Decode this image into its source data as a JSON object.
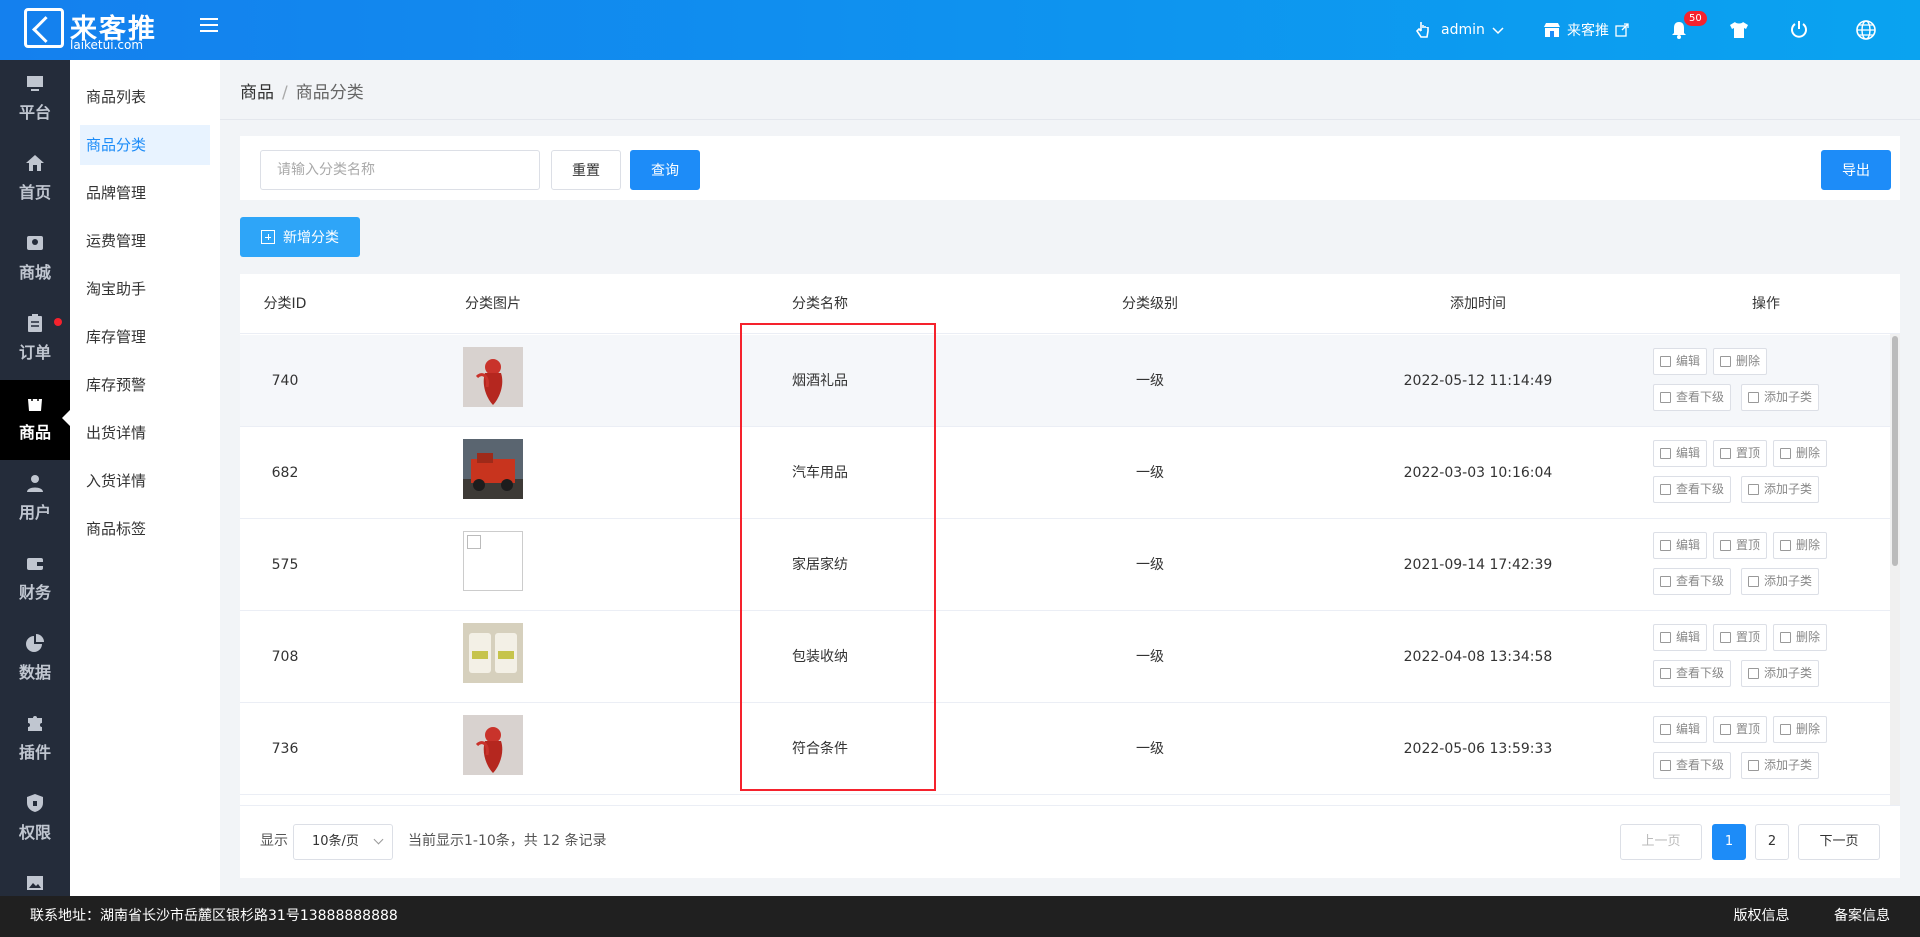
{
  "brand": {
    "name": "来客推",
    "domain": "laiketui.com"
  },
  "header": {
    "user": "admin",
    "store": "来客推",
    "notifications": "50"
  },
  "rail": [
    {
      "label": "平台",
      "icon": "platform-icon"
    },
    {
      "label": "首页",
      "icon": "home-icon"
    },
    {
      "label": "商城",
      "icon": "mall-icon"
    },
    {
      "label": "订单",
      "icon": "order-icon"
    },
    {
      "label": "商品",
      "icon": "goods-icon",
      "active": true
    },
    {
      "label": "用户",
      "icon": "user-icon"
    },
    {
      "label": "财务",
      "icon": "wallet-icon"
    },
    {
      "label": "数据",
      "icon": "pie-chart-icon"
    },
    {
      "label": "插件",
      "icon": "puzzle-icon"
    },
    {
      "label": "权限",
      "icon": "shield-icon"
    },
    {
      "label": "",
      "icon": "image-icon"
    }
  ],
  "submenu": [
    {
      "label": "商品列表"
    },
    {
      "label": "商品分类",
      "active": true
    },
    {
      "label": "品牌管理"
    },
    {
      "label": "运费管理"
    },
    {
      "label": "淘宝助手"
    },
    {
      "label": "库存管理"
    },
    {
      "label": "库存预警"
    },
    {
      "label": "出货详情"
    },
    {
      "label": "入货详情"
    },
    {
      "label": "商品标签"
    }
  ],
  "breadcrumb": {
    "parent": "商品",
    "separator": "/",
    "current": "商品分类"
  },
  "search": {
    "placeholder": "请输入分类名称",
    "reset": "重置",
    "query": "查询",
    "export": "导出"
  },
  "add_button": "新增分类",
  "table": {
    "columns": [
      "分类ID",
      "分类图片",
      "分类名称",
      "分类级别",
      "添加时间",
      "操作"
    ],
    "rows": [
      {
        "id": "740",
        "name": "烟酒礼品",
        "level": "一级",
        "time": "2022-05-12 11:14:49",
        "image": "red-figure",
        "ops": [
          "编辑",
          "删除",
          "查看下级",
          "添加子类"
        ]
      },
      {
        "id": "682",
        "name": "汽车用品",
        "level": "一级",
        "time": "2022-03-03 10:16:04",
        "image": "red-truck",
        "ops": [
          "编辑",
          "置顶",
          "删除",
          "查看下级",
          "添加子类"
        ]
      },
      {
        "id": "575",
        "name": "家居家纺",
        "level": "一级",
        "time": "2021-09-14 17:42:39",
        "image": "empty",
        "ops": [
          "编辑",
          "置顶",
          "删除",
          "查看下级",
          "添加子类"
        ]
      },
      {
        "id": "708",
        "name": "包装收纳",
        "level": "一级",
        "time": "2022-04-08 13:34:58",
        "image": "boxes",
        "ops": [
          "编辑",
          "置顶",
          "删除",
          "查看下级",
          "添加子类"
        ]
      },
      {
        "id": "736",
        "name": "符合条件",
        "level": "一级",
        "time": "2022-05-06 13:59:33",
        "image": "red-figure",
        "ops": [
          "编辑",
          "置顶",
          "删除",
          "查看下级",
          "添加子类"
        ]
      }
    ]
  },
  "pagination": {
    "show_label": "显示",
    "page_size": "10条/页",
    "summary": "当前显示1-10条，共 12 条记录",
    "prev": "上一页",
    "pages": [
      "1",
      "2"
    ],
    "current": "1",
    "next": "下一页"
  },
  "footer": {
    "address": "联系地址：湖南省长沙市岳麓区银杉路31号13888888888",
    "copyright": "版权信息",
    "record": "备案信息"
  },
  "colors": {
    "primary": "#1d8cf8",
    "header_start": "#1480ee",
    "header_end": "#0aa3f0",
    "rail_bg": "#242c3a",
    "highlight_box": "#f5222d"
  }
}
